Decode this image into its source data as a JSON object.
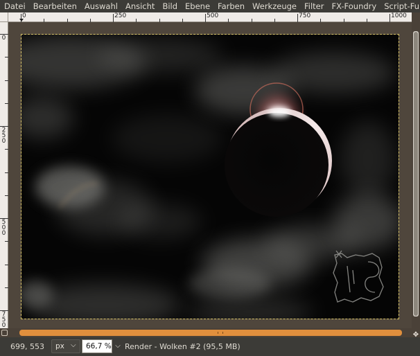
{
  "menubar": {
    "items": [
      "Datei",
      "Bearbeiten",
      "Auswahl",
      "Ansicht",
      "Bild",
      "Ebene",
      "Farben",
      "Werkzeuge",
      "Filter",
      "FX-Foundry",
      "Script-Fu",
      "U"
    ]
  },
  "rulers": {
    "horizontal": [
      "0",
      "250",
      "500",
      "750",
      "1000"
    ],
    "vertical": [
      "0",
      "250",
      "500",
      "750"
    ]
  },
  "statusbar": {
    "coords": "699, 553",
    "unit": "px",
    "zoom": "66,7 %",
    "message": "Render - Wolken #2 (95,5 MB)"
  },
  "icons": {
    "unit_dropdown": "chevron-down-icon",
    "zoom_dropdown": "chevron-down-icon",
    "navigate": "navigate-icon",
    "quickmask": "quickmask-icon",
    "scroll_grip": "grip-icon"
  },
  "colors": {
    "menubar_bg": "#3c3b37",
    "canvas_bg": "#4f463c",
    "selection_border": "#d9c56a",
    "scrollbar": "#e08f3d",
    "sky": "#050505",
    "cloud": "#8a8a86",
    "eclipse_glow": "#d88a8a"
  }
}
